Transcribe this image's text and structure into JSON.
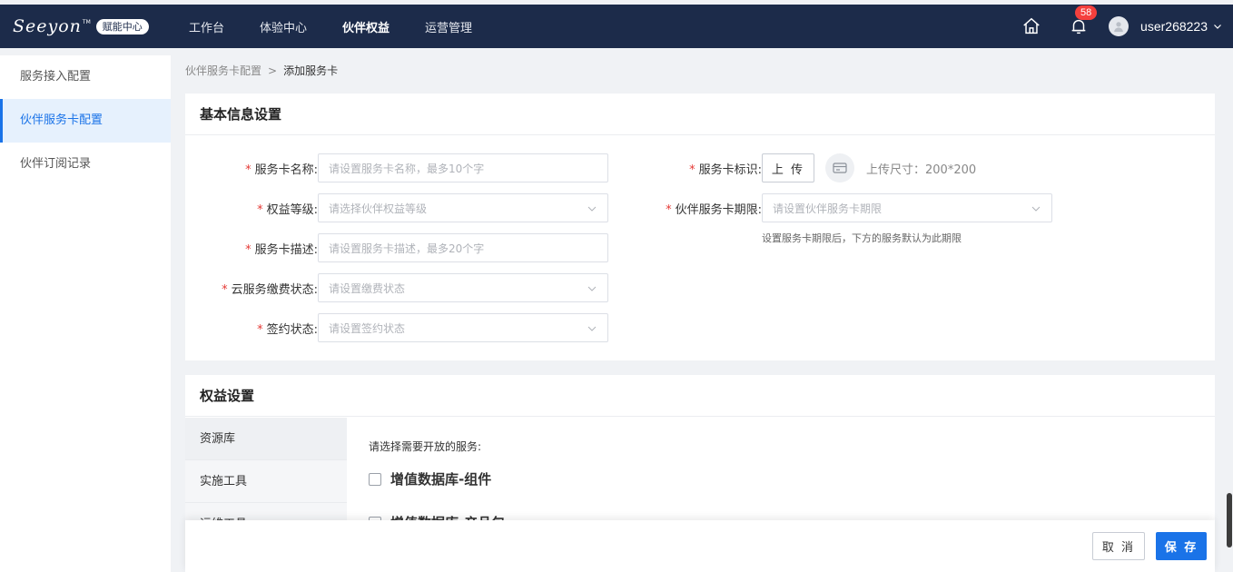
{
  "header": {
    "logo_text": "Seeyon",
    "logo_tm": "TM",
    "logo_badge": "赋能中心",
    "nav": [
      {
        "label": "工作台"
      },
      {
        "label": "体验中心"
      },
      {
        "label": "伙伴权益",
        "active": true
      },
      {
        "label": "运营管理"
      }
    ],
    "notification_count": "58",
    "username": "user268223"
  },
  "sidebar": {
    "items": [
      {
        "label": "服务接入配置"
      },
      {
        "label": "伙伴服务卡配置",
        "active": true
      },
      {
        "label": "伙伴订阅记录"
      }
    ]
  },
  "breadcrumb": {
    "parent": "伙伴服务卡配置",
    "separator": ">",
    "current": "添加服务卡"
  },
  "basic_info": {
    "title": "基本信息设置",
    "required_mark": "*",
    "card_name": {
      "label": "服务卡名称:",
      "placeholder": "请设置服务卡名称，最多10个字"
    },
    "rights_level": {
      "label": "权益等级:",
      "placeholder": "请选择伙伴权益等级"
    },
    "card_desc": {
      "label": "服务卡描述:",
      "placeholder": "请设置服务卡描述，最多20个字"
    },
    "cloud_fee_status": {
      "label": "云服务缴费状态:",
      "placeholder": "请设置缴费状态"
    },
    "sign_status": {
      "label": "签约状态:",
      "placeholder": "请设置签约状态"
    },
    "card_logo": {
      "label": "服务卡标识:",
      "upload_label": "上 传",
      "size_hint": "上传尺寸：200*200"
    },
    "card_period": {
      "label": "伙伴服务卡期限:",
      "placeholder": "请设置伙伴服务卡期限",
      "hint": "设置服务卡期限后，下方的服务默认为此期限"
    }
  },
  "rights": {
    "title": "权益设置",
    "tabs": [
      {
        "label": "资源库",
        "active": true
      },
      {
        "label": "实施工具"
      },
      {
        "label": "运维工具"
      }
    ],
    "service_prompt": "请选择需要开放的服务:",
    "services": [
      {
        "label": "增值数据库-组件",
        "checked": false
      },
      {
        "label": "增值数据库-产品包",
        "checked": false
      }
    ]
  },
  "footer": {
    "cancel_label": "取 消",
    "save_label": "保 存"
  },
  "colors": {
    "topbar": "#1c2b4a",
    "accent": "#1a73e8",
    "required": "#e53935",
    "badge": "#f5403d"
  },
  "icons": [
    "home-icon",
    "bell-icon",
    "user-avatar-icon",
    "chevron-down-icon",
    "card-icon"
  ]
}
